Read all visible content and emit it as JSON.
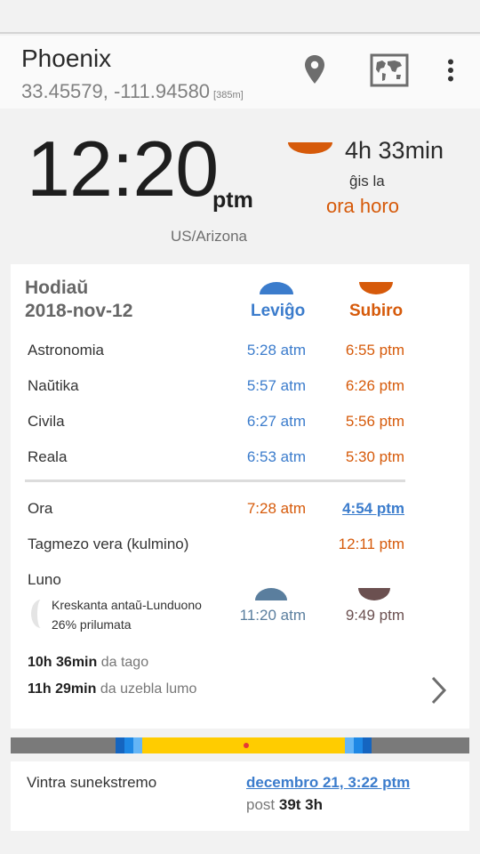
{
  "location": {
    "city": "Phoenix",
    "coordinates": "33.45579, -111.94580",
    "altitude": "[385m]"
  },
  "clock": {
    "time": "12:20",
    "ampm": "ptm",
    "timezone": "US/Arizona"
  },
  "countdown": {
    "duration": "4h 33min",
    "until_label": "ĝis la",
    "event": "ora horo"
  },
  "today": {
    "label": "Hodiaŭ",
    "date": "2018-nov-12",
    "rise_header": "Leviĝo",
    "set_header": "Subiro",
    "twilight_rows": [
      {
        "label": "Astronomia",
        "rise": "5:28 atm",
        "set": "6:55 ptm"
      },
      {
        "label": "Naŭtika",
        "rise": "5:57 atm",
        "set": "6:26 ptm"
      },
      {
        "label": "Civila",
        "rise": "6:27 atm",
        "set": "5:56 ptm"
      },
      {
        "label": "Reala",
        "rise": "6:53 atm",
        "set": "5:30 ptm"
      }
    ],
    "golden": {
      "label": "Ora",
      "rise": "7:28 atm",
      "set": "4:54 ptm"
    },
    "noon": {
      "label": "Tagmezo vera (kulmino)",
      "time": "12:11 ptm"
    },
    "moon": {
      "label": "Luno",
      "phase": "Kreskanta antaŭ-Lunduono",
      "illumination": "26% prilumata",
      "rise": "11:20 atm",
      "set": "9:49 ptm"
    },
    "day_length": {
      "value": "10h 36min",
      "suffix": "da tago"
    },
    "light_length": {
      "value": "11h 29min",
      "suffix": "da uzebla lumo"
    }
  },
  "solstice": {
    "label": "Vintra sunekstremo",
    "date": "decembro 21, 3:22 ptm",
    "after_prefix": "post",
    "after_value": "39t 3h"
  },
  "colors": {
    "rise_blue": "#3b7ccc",
    "set_orange": "#d65a0a",
    "moon_rise": "#5a7e9e",
    "moon_set": "#6b5050",
    "timeline_day": "#ffcc00",
    "timeline_twilight": "#1e88e5",
    "timeline_night": "#7a7a7a"
  },
  "icons": {
    "location": "location-pin-icon",
    "map": "world-map-icon",
    "more": "overflow-menu-icon",
    "next": "chevron-right-icon"
  }
}
